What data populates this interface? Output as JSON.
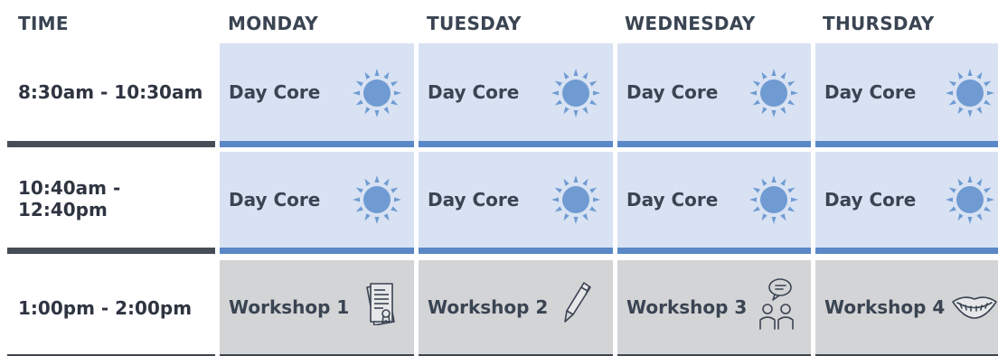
{
  "headers": [
    "TIME",
    "MONDAY",
    "TUESDAY",
    "WEDNESDAY",
    "THURSDAY"
  ],
  "rows": [
    {
      "time": "8:30am - 10:30am",
      "cells": [
        {
          "label": "Day Core",
          "icon": "sun-icon"
        },
        {
          "label": "Day Core",
          "icon": "sun-icon"
        },
        {
          "label": "Day Core",
          "icon": "sun-icon"
        },
        {
          "label": "Day Core",
          "icon": "sun-icon"
        }
      ]
    },
    {
      "time": "10:40am - 12:40pm",
      "cells": [
        {
          "label": "Day Core",
          "icon": "sun-icon"
        },
        {
          "label": "Day Core",
          "icon": "sun-icon"
        },
        {
          "label": "Day Core",
          "icon": "sun-icon"
        },
        {
          "label": "Day Core",
          "icon": "sun-icon"
        }
      ]
    },
    {
      "time": "1:00pm - 2:00pm",
      "cells": [
        {
          "label": "Workshop 1",
          "icon": "certificate-document-icon"
        },
        {
          "label": "Workshop 2",
          "icon": "pen-icon"
        },
        {
          "label": "Workshop 3",
          "icon": "people-talking-icon"
        },
        {
          "label": "Workshop 4",
          "icon": "smiling-mouth-icon"
        }
      ]
    }
  ],
  "colors": {
    "day_core_bg": "#d8e2f3",
    "day_core_accent": "#5a88c6",
    "workshop_bg": "#d3d4d6",
    "sun_fill": "#6f9bd2",
    "divider": "#454d56",
    "text": "#3a4452"
  }
}
